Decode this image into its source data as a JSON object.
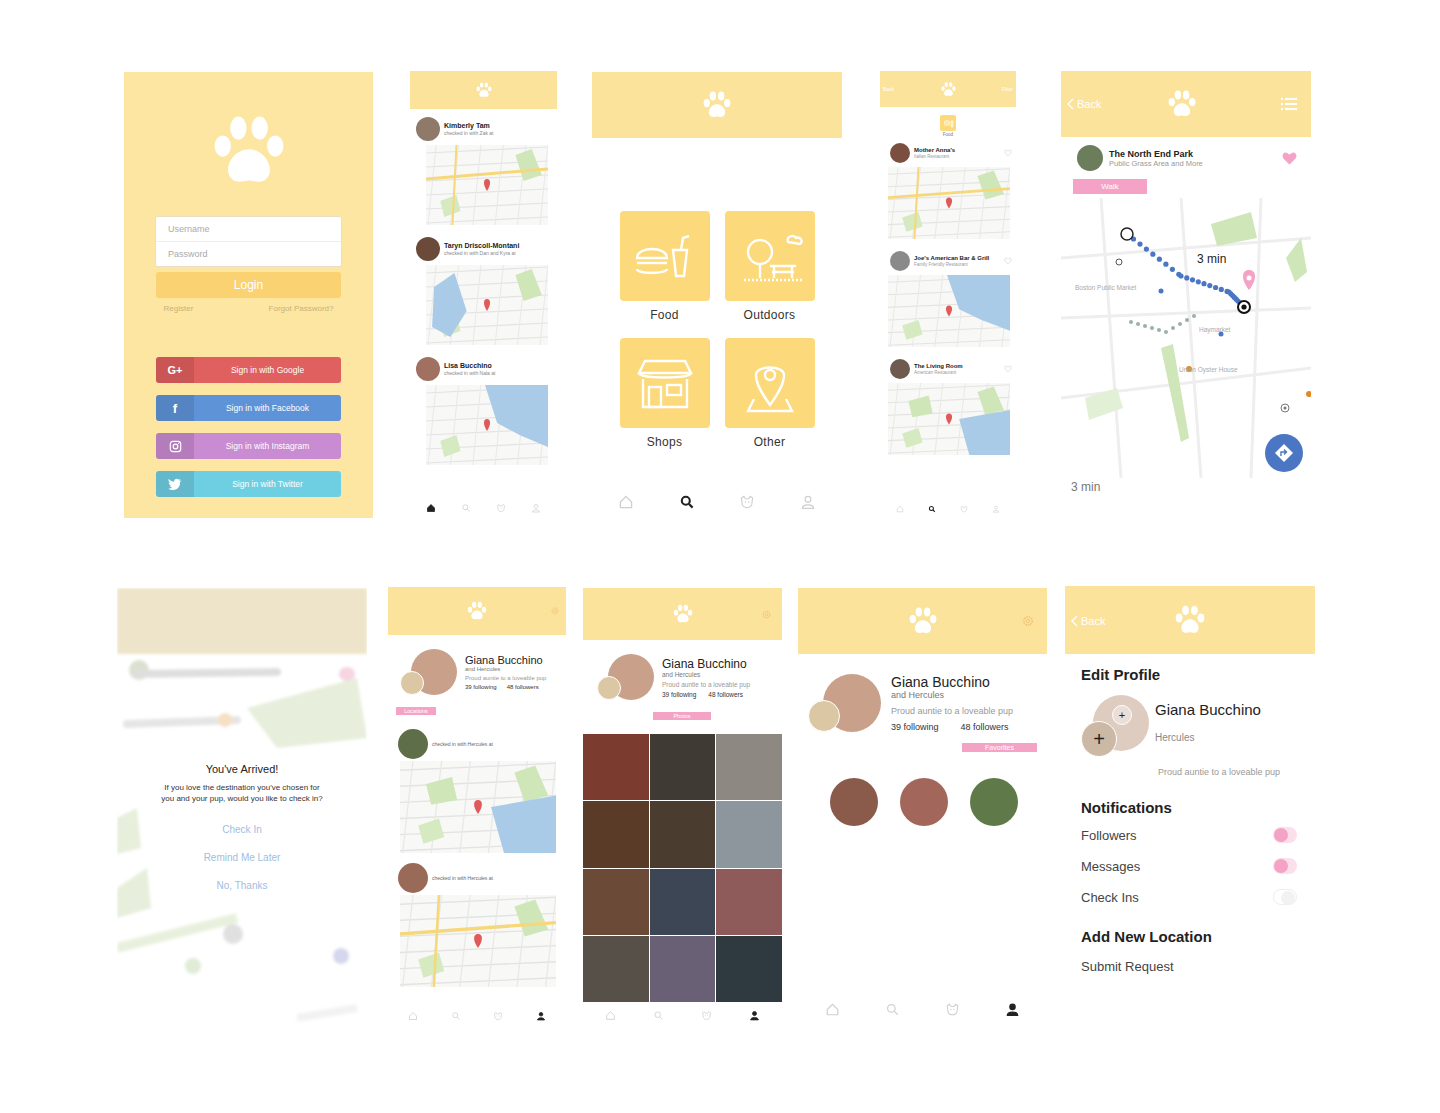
{
  "screens": {
    "login": {
      "username": "Username",
      "password": "Password",
      "login_button": "Login",
      "register": "Register",
      "forgot": "Forgot Password?",
      "social": [
        {
          "kind": "google",
          "icon": "G+",
          "label": "Sign in with Google",
          "color": "#e0605f"
        },
        {
          "kind": "facebook",
          "icon": "f",
          "label": "Sign in with Facebook",
          "color": "#5f93d8"
        },
        {
          "kind": "instagram",
          "label": "Sign in with Instagram",
          "color": "#c98bd1"
        },
        {
          "kind": "twitter",
          "label": "Sign in with Twitter",
          "color": "#6fcfe2"
        }
      ]
    },
    "feed": {
      "posts": [
        {
          "name": "Kimberly Tam",
          "caption": "checked in with Zak at"
        },
        {
          "name": "Taryn Driscoll-Montani",
          "caption": "checked in with Dan and Kyra at"
        },
        {
          "name": "Lisa Bucchino",
          "caption": "checked in with Nala at"
        }
      ],
      "nav": [
        {
          "kind": "home",
          "selected": true
        },
        {
          "kind": "search",
          "selected": false
        },
        {
          "kind": "dog",
          "selected": false
        },
        {
          "kind": "profile",
          "selected": false
        }
      ]
    },
    "categories": {
      "items": [
        {
          "kind": "food",
          "label": "Food"
        },
        {
          "kind": "outdoors",
          "label": "Outdoors"
        },
        {
          "kind": "shops",
          "label": "Shops"
        },
        {
          "kind": "other",
          "label": "Other"
        }
      ],
      "nav": [
        {
          "kind": "home",
          "selected": false
        },
        {
          "kind": "search",
          "selected": true
        },
        {
          "kind": "dog",
          "selected": false
        },
        {
          "kind": "profile",
          "selected": false
        }
      ]
    },
    "place_list": {
      "back": "Back",
      "filter": "Filter",
      "category": "Food",
      "places": [
        {
          "name": "Mother Anna's",
          "subtitle": "Italian Restaurant",
          "favorite": false
        },
        {
          "name": "Joe's American Bar & Grill",
          "subtitle": "Family Friendly Restaurant",
          "favorite": false
        },
        {
          "name": "The Living Room",
          "subtitle": "American Restaurant",
          "favorite": false
        }
      ],
      "nav": [
        {
          "kind": "home",
          "selected": false
        },
        {
          "kind": "search",
          "selected": true
        },
        {
          "kind": "dog",
          "selected": false
        },
        {
          "kind": "profile",
          "selected": false
        }
      ]
    },
    "place_detail": {
      "back": "Back",
      "name": "The North End Park",
      "subtitle": "Public Grass Area and More",
      "favorite": true,
      "mode": "Walk",
      "route_time": "3 min",
      "eta": "3 min",
      "map_labels": [
        "Boston Public Market",
        "Haymarket",
        "Union Oyster House"
      ]
    },
    "arrived": {
      "title": "You've Arrived!",
      "body": "If you love the destination you've chosen for you and your pup, would you like to check in?",
      "actions": [
        "Check In",
        "Remind Me Later",
        "No, Thanks"
      ]
    },
    "profile": {
      "name": "Giana Bucchino",
      "pet": "and Hercules",
      "bio": "Proud auntie to a loveable pup",
      "following": "39 following",
      "followers": "48 followers"
    },
    "profile_locations": {
      "tab": "Locations",
      "checkins": [
        {
          "caption": "checked in with Hercules at"
        },
        {
          "caption": "checked in with Hercules at"
        }
      ],
      "nav": [
        {
          "kind": "home",
          "selected": false
        },
        {
          "kind": "search",
          "selected": false
        },
        {
          "kind": "dog",
          "selected": false
        },
        {
          "kind": "profile",
          "selected": true
        }
      ]
    },
    "profile_photos": {
      "tab": "Photos",
      "nav": [
        {
          "kind": "home",
          "selected": false
        },
        {
          "kind": "search",
          "selected": false
        },
        {
          "kind": "dog",
          "selected": false
        },
        {
          "kind": "profile",
          "selected": true
        }
      ]
    },
    "profile_favorites": {
      "tab": "Favorites",
      "nav": [
        {
          "kind": "home",
          "selected": false
        },
        {
          "kind": "search",
          "selected": false
        },
        {
          "kind": "dog",
          "selected": false
        },
        {
          "kind": "profile",
          "selected": true
        }
      ]
    },
    "edit_profile": {
      "back": "Back",
      "title": "Edit Profile",
      "name": "Giana Bucchino",
      "pet": "Hercules",
      "bio": "Proud auntie to a loveable pup",
      "add_icon": "+",
      "notifications_title": "Notifications",
      "toggles": [
        {
          "label": "Followers",
          "on": true
        },
        {
          "label": "Messages",
          "on": true
        },
        {
          "label": "Check Ins",
          "on": false
        }
      ],
      "location_title": "Add New Location",
      "location_action": "Submit Request"
    }
  }
}
